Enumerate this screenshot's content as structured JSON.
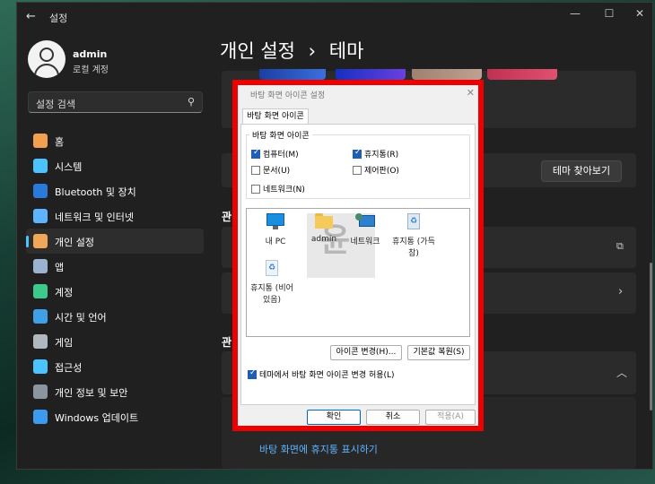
{
  "window": {
    "title": "설정",
    "back_glyph": "←",
    "min_glyph": "—",
    "max_glyph": "☐",
    "close_glyph": "✕"
  },
  "profile": {
    "name": "admin",
    "subtitle": "로컬 계정"
  },
  "search": {
    "placeholder": "설정 검색"
  },
  "nav": {
    "items": [
      {
        "label": "홈",
        "icon": "home-icon",
        "color": "#f0a050"
      },
      {
        "label": "시스템",
        "icon": "system-icon",
        "color": "#4cc2ff"
      },
      {
        "label": "Bluetooth 및 장치",
        "icon": "bluetooth-icon",
        "color": "#2a7ad9"
      },
      {
        "label": "네트워크 및 인터넷",
        "icon": "wifi-icon",
        "color": "#5fb4ff"
      },
      {
        "label": "개인 설정",
        "icon": "brush-icon",
        "color": "#f2a65a"
      },
      {
        "label": "앱",
        "icon": "apps-icon",
        "color": "#9bb3d0"
      },
      {
        "label": "계정",
        "icon": "account-icon",
        "color": "#3cc98a"
      },
      {
        "label": "시간 및 언어",
        "icon": "globe-icon",
        "color": "#3fa0e6"
      },
      {
        "label": "게임",
        "icon": "gamepad-icon",
        "color": "#b0b8c0"
      },
      {
        "label": "접근성",
        "icon": "accessibility-icon",
        "color": "#4cc2ff"
      },
      {
        "label": "개인 정보 및 보안",
        "icon": "shield-icon",
        "color": "#8a95a0"
      },
      {
        "label": "Windows 업데이트",
        "icon": "update-icon",
        "color": "#3d9bef"
      }
    ],
    "active_index": 4
  },
  "header": {
    "parent": "개인 설정",
    "separator": "›",
    "current": "테마"
  },
  "content": {
    "find_themes_button": "테마 찾아보기",
    "section1_fragment": "관",
    "section2_fragment": "관",
    "link_bottom": "바탕 화면에 휴지통 표시하기"
  },
  "dialog": {
    "title": "바탕 화면 아이콘 설정",
    "tab": "바탕 화면 아이콘",
    "group_title": "바탕 화면 아이콘",
    "checkboxes": [
      {
        "label": "컴퓨터(M)",
        "checked": true
      },
      {
        "label": "휴지통(R)",
        "checked": true
      },
      {
        "label": "문서(U)",
        "checked": false
      },
      {
        "label": "제어판(O)",
        "checked": false
      },
      {
        "label": "네트워크(N)",
        "checked": false
      }
    ],
    "icons": [
      {
        "label": "내 PC",
        "icon": "monitor-icon"
      },
      {
        "label": "admin",
        "icon": "folder-icon"
      },
      {
        "label": "네트워크",
        "icon": "network-icon"
      },
      {
        "label": "휴지통 (가득 참)",
        "icon": "recycle-bin-full-icon"
      },
      {
        "label": "휴지통 (비어 있음)",
        "icon": "recycle-bin-empty-icon"
      }
    ],
    "watermark": "윤",
    "change_icon_button": "아이콘 변경(H)...",
    "restore_default_button": "기본값 복원(S)",
    "allow_theme_checkbox": {
      "label": "테마에서 바탕 화면 아이콘 변경 허용(L)",
      "checked": true
    },
    "ok_button": "확인",
    "cancel_button": "취소",
    "apply_button": "적용(A)",
    "highlight_color": "#ee0000"
  }
}
